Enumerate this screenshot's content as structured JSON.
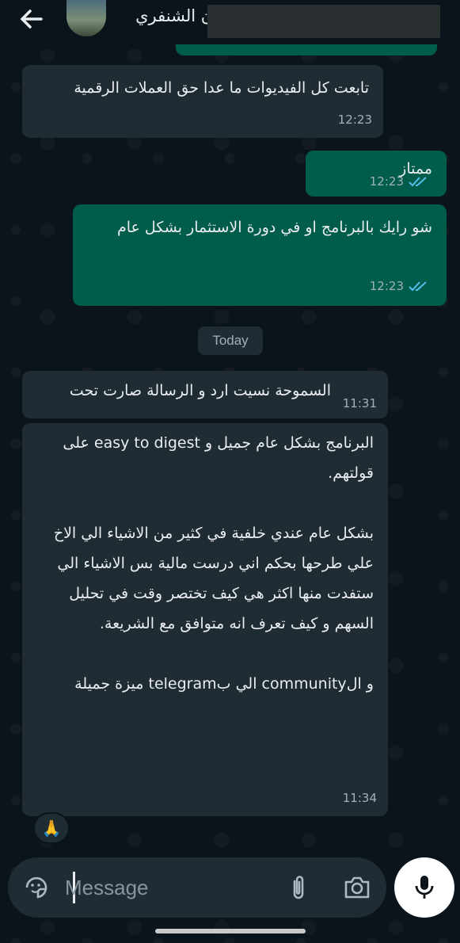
{
  "header": {
    "contact_name": "ان الشنفري",
    "back_icon": "arrow-left-icon"
  },
  "messages": [
    {
      "direction": "in",
      "text": "تابعت كل الفيديوات ما عدا حق العملات الرقمية",
      "time": "12:23"
    },
    {
      "direction": "out",
      "text": "ممتاز",
      "time": "12:23",
      "status": "read"
    },
    {
      "direction": "out",
      "text": "شو رايك بالبرنامج او في دورة الاستثمار بشكل عام",
      "time": "12:23",
      "status": "read"
    },
    {
      "direction": "in",
      "text": "السموحة نسيت ارد و الرسالة صارت تحت",
      "time": "11:31"
    },
    {
      "direction": "in",
      "text": "البرنامج بشكل عام جميل و easy to digest على قولتهم.\n\nبشكل عام عندي خلفية في كثير من الاشياء الي الاخ علي طرحها بحكم اني درست مالية بس الاشياء الي ستفدت منها اكثر هي كيف تختصر وقت في تحليل السهم و كيف تعرف انه متوافق مع الشريعة.\n\nو الcommunity الي بtelegram ميزة جميلة",
      "time": "11:34",
      "reaction": "🙏"
    }
  ],
  "date_divider": "Today",
  "composer": {
    "placeholder": "Message",
    "emoji_icon": "sticker-icon",
    "attach_icon": "paperclip-icon",
    "camera_icon": "camera-icon",
    "mic_icon": "microphone-icon"
  },
  "colors": {
    "background": "#0b141a",
    "incoming_bubble": "#1f2c34",
    "outgoing_bubble": "#005c4b",
    "read_tick": "#53bdeb"
  }
}
